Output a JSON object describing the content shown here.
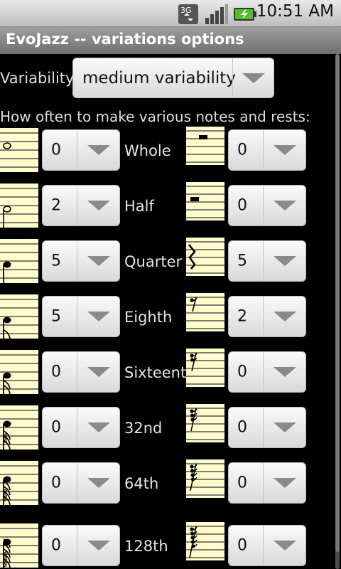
{
  "status_bar": {
    "network_label": "3G",
    "time": "10:51 AM"
  },
  "title": "EvoJazz -- variations options",
  "variability": {
    "label": "Variability:",
    "value": "medium variability"
  },
  "frequency_prompt": "How often to make various notes and rests:",
  "rows": [
    {
      "name": "Whole",
      "note_value": "0",
      "rest_value": "0"
    },
    {
      "name": "Half",
      "note_value": "2",
      "rest_value": "0"
    },
    {
      "name": "Quarter",
      "note_value": "5",
      "rest_value": "5"
    },
    {
      "name": "Eighth",
      "note_value": "5",
      "rest_value": "2"
    },
    {
      "name": "Sixteenth",
      "note_value": "0",
      "rest_value": "0"
    },
    {
      "name": "32nd",
      "note_value": "0",
      "rest_value": "0"
    },
    {
      "name": "64th",
      "note_value": "0",
      "rest_value": "0"
    },
    {
      "name": "128th",
      "note_value": "0",
      "rest_value": "0"
    }
  ],
  "colors": {
    "staff_paper": "#fffccc",
    "spinner_bg": "#e6e6e6",
    "background": "#000000"
  }
}
